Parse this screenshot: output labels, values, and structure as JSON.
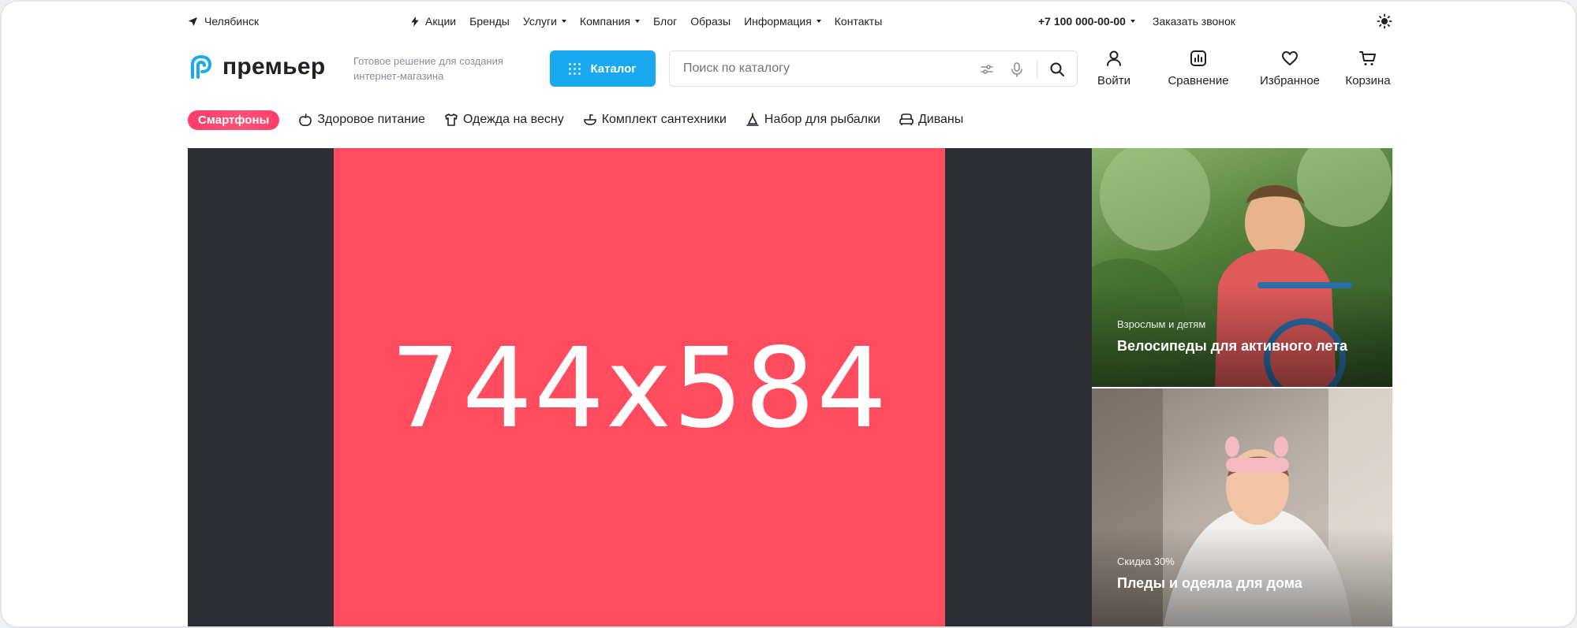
{
  "topbar": {
    "city": "Челябинск",
    "nav": [
      {
        "label": "Акции",
        "icon": "lightning-icon",
        "dropdown": false
      },
      {
        "label": "Бренды",
        "dropdown": false
      },
      {
        "label": "Услуги",
        "dropdown": true
      },
      {
        "label": "Компания",
        "dropdown": true
      },
      {
        "label": "Блог",
        "dropdown": false
      },
      {
        "label": "Образы",
        "dropdown": false
      },
      {
        "label": "Информация",
        "dropdown": true
      },
      {
        "label": "Контакты",
        "dropdown": false
      }
    ],
    "phone": "+7 100 000-00-00",
    "callback": "Заказать звонок",
    "theme_icon": "sun-icon"
  },
  "header": {
    "logo_text": "премьер",
    "tagline": "Готовое решение для создания интернет-магазина",
    "catalog_label": "Каталог",
    "search_placeholder": "Поиск по каталогу",
    "actions": [
      {
        "label": "Войти",
        "icon": "user-icon"
      },
      {
        "label": "Сравнение",
        "icon": "chart-icon"
      },
      {
        "label": "Избранное",
        "icon": "heart-icon"
      },
      {
        "label": "Корзина",
        "icon": "cart-icon"
      }
    ]
  },
  "categories": {
    "hot": "Смартфоны",
    "items": [
      {
        "label": "Здоровое питание",
        "icon": "apple-icon"
      },
      {
        "label": "Одежда на весну",
        "icon": "shirt-icon"
      },
      {
        "label": "Комплект сантехники",
        "icon": "sink-icon"
      },
      {
        "label": "Набор для рыбалки",
        "icon": "bait-icon"
      },
      {
        "label": "Диваны",
        "icon": "sofa-icon"
      }
    ]
  },
  "banners": {
    "main_text": "744x584",
    "side": [
      {
        "subtitle": "Взрослым и детям",
        "title": "Велосипеды для активного лета"
      },
      {
        "subtitle": "Скидка 30%",
        "title": "Пледы и одеяла для дома"
      }
    ]
  },
  "colors": {
    "accent": "#1aa8ee",
    "hot_chip": "#ff4d6d",
    "banner_red": "#ff4d5f",
    "banner_dark": "#2d2e33"
  }
}
